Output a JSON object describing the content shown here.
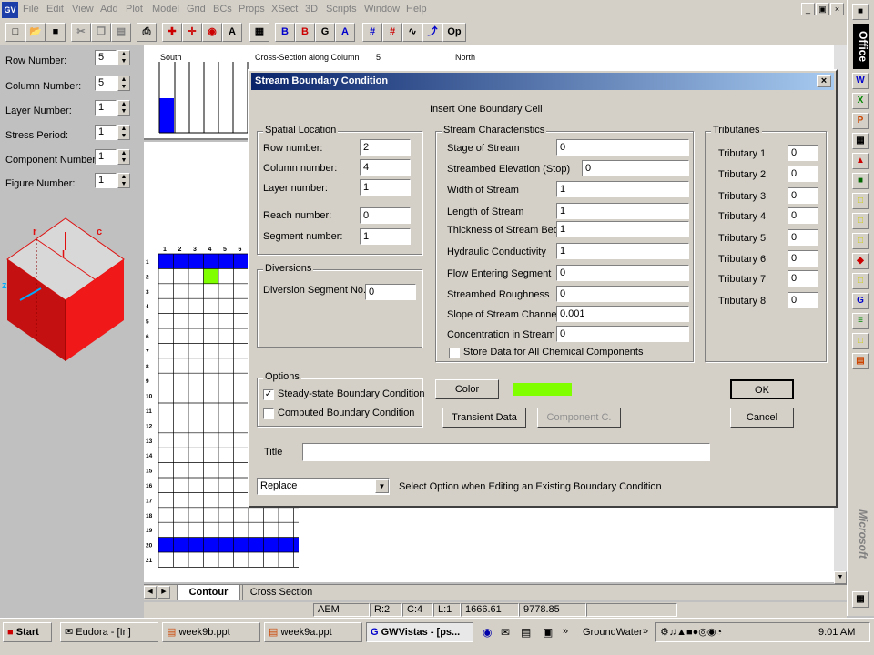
{
  "menu": {
    "app_icon": "GV",
    "items": [
      "File",
      "Edit",
      "View",
      "Add",
      "Plot",
      "Model",
      "Grid",
      "BCs",
      "Props",
      "XSect",
      "3D",
      "Scripts",
      "Window",
      "Help"
    ]
  },
  "toolbar": {
    "buttons": [
      "new-icon",
      "open-icon",
      "save-icon",
      "cut-icon",
      "copy-icon",
      "paste-icon",
      "print-icon",
      "zoom-in-icon",
      "zoom-out-icon",
      "zoom-window-icon",
      "zoom-all-icon",
      "calculator-icon",
      "bc-icon",
      "bc-red-icon",
      "grid-g-icon",
      "text-a-icon",
      "grid-icon",
      "grid-red-icon",
      "contour-icon",
      "step-icon"
    ],
    "op_label": "Op"
  },
  "left_panel": {
    "fields": [
      {
        "label": "Row Number:",
        "value": "5"
      },
      {
        "label": "Column Number:",
        "value": "5"
      },
      {
        "label": "Layer Number:",
        "value": "1"
      },
      {
        "label": "Stress Period:",
        "value": "1"
      },
      {
        "label": "Component Number:",
        "value": "1"
      },
      {
        "label": "Figure Number:",
        "value": "1"
      }
    ],
    "cube_labels": {
      "r": "r",
      "c": "c",
      "l": "l",
      "z": "z"
    }
  },
  "cross_section": {
    "left": "South",
    "title": "Cross-Section along Column",
    "column": "5",
    "right": "North"
  },
  "grid": {
    "columns": [
      "1",
      "2",
      "3",
      "4",
      "5",
      "6"
    ],
    "rows": [
      "1",
      "2",
      "3",
      "4",
      "5",
      "6",
      "7",
      "8",
      "9",
      "10",
      "11",
      "12",
      "13",
      "14",
      "15",
      "16",
      "17",
      "18",
      "19",
      "20",
      "21"
    ]
  },
  "tabs": {
    "contour": "Contour",
    "cross_section": "Cross Section"
  },
  "dialog": {
    "title": "Stream Boundary Condition",
    "heading": "Insert One Boundary Cell",
    "spatial": {
      "title": "Spatial Location",
      "row_label": "Row number:",
      "row": "2",
      "col_label": "Column number:",
      "col": "4",
      "layer_label": "Layer number:",
      "layer": "1",
      "reach_label": "Reach number:",
      "reach": "0",
      "segment_label": "Segment number:",
      "segment": "1"
    },
    "diversions": {
      "title": "Diversions",
      "label": "Diversion Segment No.",
      "value": "0"
    },
    "options": {
      "title": "Options",
      "steady_label": "Steady-state Boundary Condition",
      "steady_checked": true,
      "computed_label": "Computed Boundary Condition",
      "computed_checked": false
    },
    "stream": {
      "title": "Stream Characteristics",
      "stage_label": "Stage of Stream",
      "stage": "0",
      "elev_label": "Streambed Elevation (Stop)",
      "elev": "0",
      "width_label": "Width of Stream",
      "width": "1",
      "length_label": "Length of Stream",
      "length": "1",
      "thick_label": "Thickness of Stream Bed",
      "thick": "1",
      "hyd_label": "Hydraulic Conductivity",
      "hyd": "1",
      "flow_label": "Flow Entering Segment",
      "flow": "0",
      "rough_label": "Streambed Roughness",
      "rough": "0",
      "slope_label": "Slope of Stream Channel",
      "slope": "0.001",
      "conc_label": "Concentration in Stream",
      "conc": "0",
      "store_label": "Store Data for All Chemical Components",
      "store_checked": false
    },
    "tributaries": {
      "title": "Tributaries",
      "items": [
        {
          "label": "Tributary 1",
          "value": "0"
        },
        {
          "label": "Tributary 2",
          "value": "0"
        },
        {
          "label": "Tributary 3",
          "value": "0"
        },
        {
          "label": "Tributary 4",
          "value": "0"
        },
        {
          "label": "Tributary 5",
          "value": "0"
        },
        {
          "label": "Tributary 6",
          "value": "0"
        },
        {
          "label": "Tributary 7",
          "value": "0"
        },
        {
          "label": "Tributary 8",
          "value": "0"
        }
      ]
    },
    "color_label": "Color",
    "swatch_color": "#80ff00",
    "transient_label": "Transient Data",
    "component_label": "Component C.",
    "ok_label": "OK",
    "cancel_label": "Cancel",
    "title_label": "Title",
    "title_value": "",
    "replace_value": "Replace",
    "replace_hint": "Select Option when Editing an Existing Boundary Condition"
  },
  "status": {
    "s1": "AEM",
    "s2": "R:2",
    "s3": "C:4",
    "s4": "L:1",
    "s5": "1666.61",
    "s6": "9778.85"
  },
  "office_bar": {
    "label": "Office",
    "brand": "Microsoft"
  },
  "taskbar": {
    "start": "Start",
    "tasks": [
      "Eudora - [In]",
      "week9b.ppt",
      "week9a.ppt",
      "GWVistas - [ps..."
    ],
    "quicklaunch": "GroundWater",
    "clock": "9:01 AM"
  },
  "colors": {
    "highlight_blue": "#0000ff",
    "highlight_green": "#80ff00",
    "cube_red": "#e01010"
  }
}
